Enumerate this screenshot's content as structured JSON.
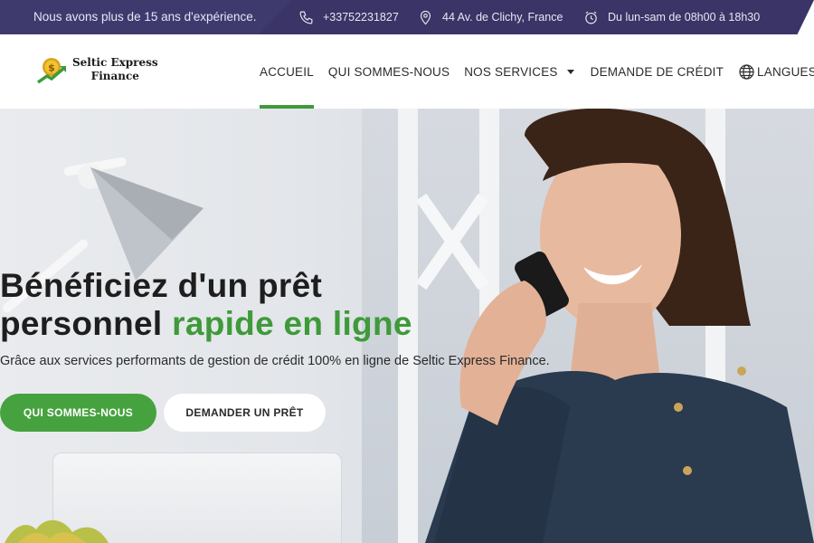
{
  "topbar": {
    "experience": "Nous avons plus de 15 ans d'expérience.",
    "phone": "+33752231827",
    "address": "44 Av. de Clichy, France",
    "hours": "Du lun-sam de 08h00 à 18h30",
    "icons": [
      "phone-icon",
      "location-pin-icon",
      "clock-icon"
    ]
  },
  "logo": {
    "line1": "Seltic Express",
    "line2": "Finance"
  },
  "nav": {
    "items": [
      {
        "label": "ACCUEIL",
        "active": true
      },
      {
        "label": "QUI SOMMES-NOUS"
      },
      {
        "label": "NOS SERVICES",
        "dropdown": true
      },
      {
        "label": "DEMANDE DE CRÉDIT"
      },
      {
        "label": "LANGUES",
        "dropdown": true,
        "icon": "globe-icon"
      }
    ]
  },
  "hero": {
    "title_line1": "Bénéficiez d'un prêt",
    "title_line2_plain": "personnel",
    "title_line2_green": "rapide en ligne",
    "subtitle": "Grâce aux services performants de gestion de crédit 100% en ligne de Seltic Express Finance.",
    "primary_button": "QUI SOMMES-NOUS",
    "secondary_button": "DEMANDER UN PRÊT"
  },
  "colors": {
    "topbar": "#3f3a6e",
    "accent_green": "#3f9a3a",
    "button_green": "#46a23e"
  }
}
